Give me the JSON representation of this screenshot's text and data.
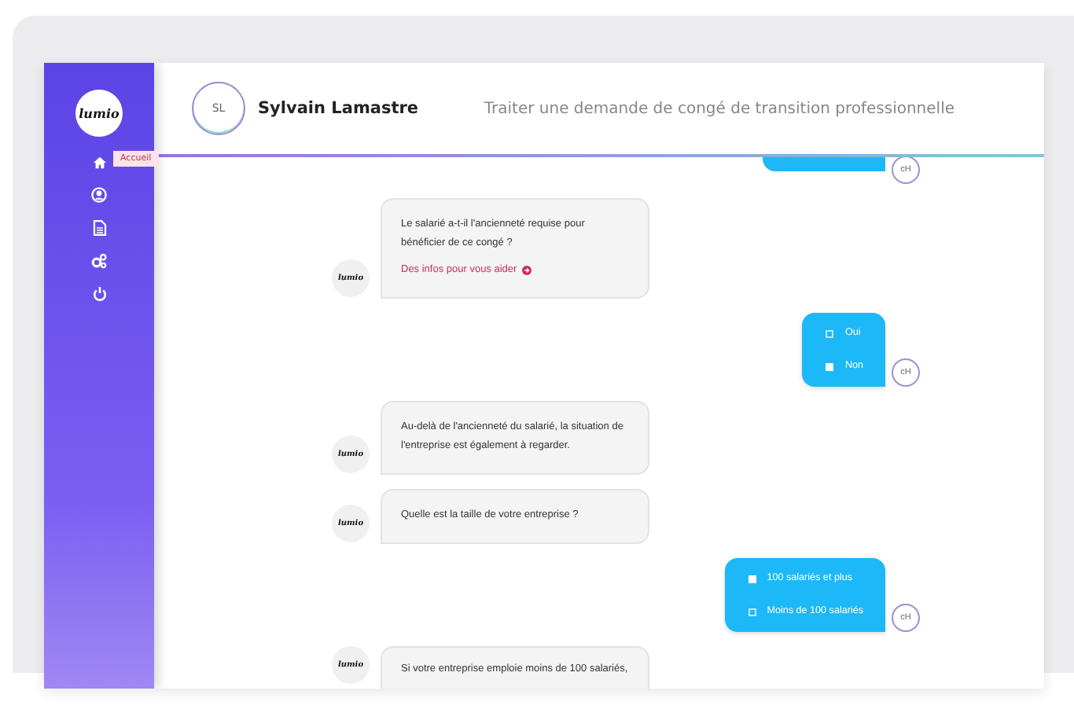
{
  "sidebar": {
    "logo": "lumio",
    "nav": [
      {
        "kind": "home",
        "tooltip": "Accueil"
      },
      {
        "kind": "user"
      },
      {
        "kind": "document"
      },
      {
        "kind": "gears"
      },
      {
        "kind": "power"
      }
    ]
  },
  "header": {
    "avatar_initials": "SL",
    "user_name": "Sylvain Lamastre",
    "title": "Traiter une demande de congé de transition professionnelle"
  },
  "messages": [
    {
      "kind": "cut",
      "avatar": "cH"
    },
    {
      "kind": "bot",
      "avatar": "lumio",
      "text": "Le salarié a-t-il l'ancienneté requise pour bénéficier de ce congé ?",
      "link": "Des infos pour vous aider"
    },
    {
      "kind": "choices",
      "avatar": "cH",
      "options": [
        {
          "label": "Oui",
          "checked": false
        },
        {
          "label": "Non",
          "checked": true
        }
      ]
    },
    {
      "kind": "bot",
      "avatar": "lumio",
      "text": "Au-delà de l'ancienneté du salarié, la situation de l'entreprise est également à regarder."
    },
    {
      "kind": "bot",
      "avatar": "lumio",
      "text": "Quelle est la taille de votre entreprise ?"
    },
    {
      "kind": "choices",
      "avatar": "cH",
      "options": [
        {
          "label": "100 salariés et plus",
          "checked": true
        },
        {
          "label": "Moins de 100 salariés",
          "checked": false
        }
      ]
    },
    {
      "kind": "bot",
      "avatar": "lumio",
      "text": "Si votre entreprise emploie moins de 100 salariés,"
    }
  ]
}
